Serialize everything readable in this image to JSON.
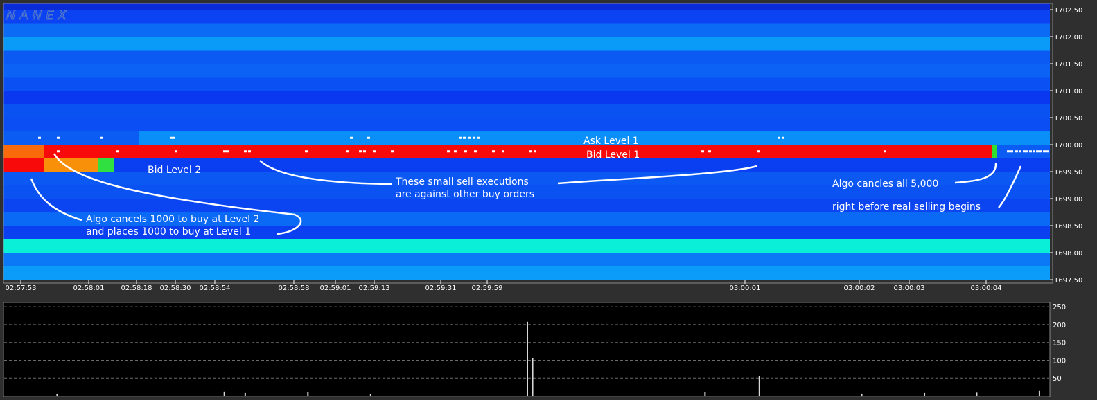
{
  "logo": "NANEX",
  "chart_data": [
    {
      "type": "heatmap",
      "title": "",
      "y_ticks": [
        "1702.50",
        "1702.00",
        "1701.50",
        "1701.00",
        "1700.50",
        "1700.00",
        "1699.50",
        "1699.00",
        "1698.50",
        "1698.00",
        "1697.50"
      ],
      "ylim": [
        1697.5,
        1702.5
      ],
      "x_ticks": [
        "02:57:53",
        "02:58:01",
        "02:58:18",
        "02:58:30",
        "02:58:54",
        "02:58:58",
        "02:59:01",
        "02:59:13",
        "02:59:31",
        "02:59:59",
        "03:00:01",
        "03:00:02",
        "03:00:03",
        "03:00:04"
      ],
      "levels": [
        {
          "price": 1702.375,
          "color": "#0b42f2"
        },
        {
          "price": 1702.125,
          "color": "#0b6bf5"
        },
        {
          "price": 1701.875,
          "color": "#0a9af8"
        },
        {
          "price": 1701.625,
          "color": "#0b5af3"
        },
        {
          "price": 1701.375,
          "color": "#0b62f4"
        },
        {
          "price": 1701.125,
          "color": "#0b50f3"
        },
        {
          "price": 1700.875,
          "color": "#0938f0"
        },
        {
          "price": 1700.625,
          "color": "#0b52f3"
        },
        {
          "price": 1700.375,
          "color": "#0b4ef3"
        },
        {
          "price": 1700.125,
          "color": "#0a8ef7",
          "label": "Ask Level 1"
        },
        {
          "price": 1699.875,
          "color": "#f80a0a",
          "label": "Bid Level 1"
        },
        {
          "price": 1699.625,
          "color": "#0a3ff1",
          "label": "Bid Level 2"
        },
        {
          "price": 1699.375,
          "color": "#0b58f3"
        },
        {
          "price": 1699.125,
          "color": "#0b52f3"
        },
        {
          "price": 1698.875,
          "color": "#0b45f2"
        },
        {
          "price": 1698.625,
          "color": "#0b6af5"
        },
        {
          "price": 1698.375,
          "color": "#0b40f1"
        },
        {
          "price": 1698.125,
          "color": "#0af0d8"
        },
        {
          "price": 1697.875,
          "color": "#0b78f6"
        },
        {
          "price": 1697.625,
          "color": "#0a9cf8"
        }
      ],
      "annotations": [
        "Ask Level 1",
        "Bid Level 1",
        "Bid Level 2",
        "These small sell executions",
        "are against other buy orders",
        "Algo cancles all 5,000",
        "right before real selling begins",
        "Algo cancels 1000 to buy at Level 2",
        "and places 1000 to buy at Level 1"
      ]
    },
    {
      "type": "bar",
      "title": "",
      "y_ticks": [
        "250",
        "200",
        "150",
        "100",
        "50"
      ],
      "ylim": [
        0,
        260
      ],
      "bars": [
        {
          "x": 0.5,
          "value": 208
        },
        {
          "x": 0.505,
          "value": 105
        },
        {
          "x": 0.722,
          "value": 55
        },
        {
          "x": 0.21,
          "value": 12
        },
        {
          "x": 0.23,
          "value": 8
        },
        {
          "x": 0.29,
          "value": 10
        },
        {
          "x": 0.67,
          "value": 11
        },
        {
          "x": 0.99,
          "value": 14
        },
        {
          "x": 0.05,
          "value": 6
        },
        {
          "x": 0.35,
          "value": 5
        },
        {
          "x": 0.82,
          "value": 6
        },
        {
          "x": 0.88,
          "value": 8
        },
        {
          "x": 0.93,
          "value": 9
        }
      ]
    }
  ]
}
